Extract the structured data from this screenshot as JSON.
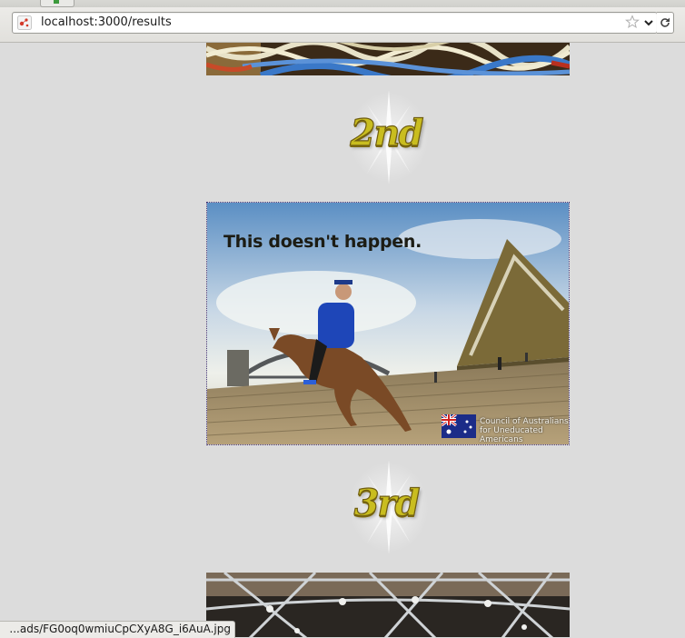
{
  "browser": {
    "url": "localhost:3000/results",
    "status_text": "...ads/FG0oq0wmiuCpCXyA8G_i6AuA.jpg"
  },
  "results": {
    "second_place_label": "2nd",
    "third_place_label": "3rd",
    "poster": {
      "headline": "This doesn't happen.",
      "council_text": "Council of Australians for Uneducated Americans"
    }
  },
  "colors": {
    "badge_gold": "#c9bd1f",
    "page_bg": "#dcdcdc"
  }
}
